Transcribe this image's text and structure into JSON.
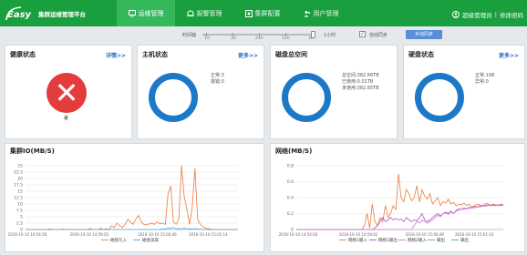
{
  "app": {
    "logo_text": "Easy",
    "name": "集群运维管理平台"
  },
  "nav": [
    {
      "label": "运维管理",
      "icon": "monitor-icon",
      "active": true
    },
    {
      "label": "报警管理",
      "icon": "alarm-icon",
      "active": false
    },
    {
      "label": "集群配置",
      "icon": "cluster-config-icon",
      "active": false
    },
    {
      "label": "用户管理",
      "icon": "users-icon",
      "active": false
    }
  ],
  "user": {
    "icon": "user-circle-icon",
    "role": "超级管理员",
    "separator": "|",
    "change_password": "修改密码"
  },
  "toolbar": {
    "time_label": "时间轴",
    "ticks": [
      "1d",
      "3d",
      "24h",
      "12h",
      "3h"
    ],
    "slider_value": "1小时",
    "auto_sync_label": "自动同步",
    "auto_sync_checked": true,
    "sync_button": "手动同步"
  },
  "health": {
    "title": "健康状态",
    "more": "详情>>",
    "status_icon": "error-x-icon",
    "status_text": "差",
    "status_color": "#e43c3c"
  },
  "hosts": {
    "title": "主机状态",
    "more": "更多>>",
    "lines": [
      "正常:3",
      "报错:0"
    ]
  },
  "disk_total": {
    "title": "磁盘总空间",
    "lines": [
      "总空间:382.66TB",
      "已使用:0.01TB",
      "未使用:382.65TB"
    ]
  },
  "disk_status": {
    "title": "硬盘状态",
    "more": "更多>>",
    "lines": [
      "正常:108",
      "异常:0"
    ]
  },
  "ring_color": "#1d78c8",
  "io_chart": {
    "title": "集群IO(MB/S)",
    "chart_data": {
      "type": "line",
      "title": "集群IO(MB/S)",
      "ylim": [
        0,
        25
      ],
      "y_ticks": [
        "0",
        "2.5",
        "5",
        "7.5",
        "10",
        "12.5",
        "15",
        "17.5",
        "20",
        "22.5",
        "25"
      ],
      "x_ticks": [
        "2016-10-10 14:54:26",
        "2016-10-10 14:59:02",
        "2016-10-10 15:00:46",
        "2016-10-10 15:01:14"
      ],
      "series": [
        {
          "name": "磁盘写入",
          "color": "#e87b3c",
          "values": [
            0,
            0,
            0,
            0,
            0,
            0,
            0,
            0,
            0,
            0.3,
            0,
            0,
            0,
            0,
            0.2,
            0,
            0,
            0,
            0,
            0,
            0,
            0,
            0,
            0,
            0.4,
            0,
            0,
            0,
            0.5,
            0,
            0.3,
            0,
            1.5,
            0.8,
            2.5,
            1.5,
            0.7,
            2,
            4,
            3,
            2,
            4,
            5.5,
            3,
            2,
            1.8,
            2.2,
            2.5,
            2,
            3,
            2.2,
            2.5,
            2,
            14,
            17,
            3,
            2,
            4,
            25,
            13,
            8,
            2,
            9,
            24,
            4,
            2,
            1,
            0.5,
            0.3,
            0.1,
            0,
            0,
            0,
            0,
            0,
            0,
            0,
            0,
            0,
            0
          ]
        },
        {
          "name": "磁盘读取",
          "color": "#5aa8e0",
          "values": [
            0,
            0,
            0,
            0,
            0,
            0,
            0,
            0,
            0,
            0,
            0,
            0,
            0,
            0,
            0,
            0,
            0,
            0,
            0,
            0,
            0,
            0,
            0,
            0,
            0,
            0,
            0,
            0,
            0,
            0,
            0,
            0,
            0,
            0,
            0,
            0,
            0,
            0,
            0,
            0,
            0,
            0,
            0,
            0,
            0,
            0,
            0,
            0,
            0,
            0,
            0,
            0.3,
            0.2,
            0.6,
            0.4,
            0.8,
            0.3,
            0.4,
            0.2,
            0.5,
            0.2,
            0.3,
            0.2,
            0.4,
            0.2,
            0.1,
            0,
            0,
            0,
            0,
            0,
            0,
            0,
            0,
            0,
            0,
            0,
            0,
            0,
            0
          ]
        }
      ]
    }
  },
  "net_chart": {
    "title": "网络(MB/S)",
    "chart_data": {
      "type": "line",
      "title": "网络(MB/S)",
      "ylim": [
        0,
        0.8
      ],
      "y_ticks": [
        "0",
        "0.2",
        "0.4",
        "0.6",
        "0.8"
      ],
      "x_ticks": [
        "2016-10-10 14:54:26",
        "2016-10-10 14:59:02",
        "2016-10-10 15:00:46",
        "2016-10-10 15:01:14"
      ],
      "legend": [
        "网络1输入",
        "网络1输出",
        "网络2输入",
        "输出",
        "输出"
      ],
      "series": [
        {
          "name": "网络1输入",
          "color": "#e87b3c",
          "values": [
            0,
            0,
            0,
            0,
            0,
            0,
            0,
            0,
            0,
            0,
            0,
            0,
            0,
            0,
            0,
            0,
            0,
            0,
            0,
            0,
            0,
            0,
            0,
            0,
            0,
            0,
            0.05,
            0.2,
            0.02,
            0.32,
            0.1,
            0.05,
            0.15,
            0.1,
            0.3,
            0.15,
            0.2,
            0.3,
            0.25,
            0.7,
            0.4,
            0.35,
            0.5,
            0.45,
            0.36,
            0.4,
            0.55,
            0.35,
            0.5,
            0.42,
            0.38,
            0.45,
            0.32,
            0.36,
            0.4,
            0.3,
            0.35,
            0.33,
            0.38,
            0.32,
            0.34,
            0.3,
            0.32,
            0.31,
            0.33,
            0.3,
            0.32,
            0.28,
            0.3,
            0.32,
            0.31,
            0.3,
            0.32,
            0.33,
            0.3,
            0.32,
            0.31,
            0.3,
            0.32,
            0.31
          ]
        },
        {
          "name": "网络1输出",
          "color": "#b04fbf",
          "values": [
            0,
            0,
            0,
            0,
            0,
            0,
            0,
            0,
            0,
            0,
            0,
            0,
            0,
            0,
            0,
            0,
            0,
            0,
            0,
            0,
            0,
            0,
            0,
            0,
            0,
            0,
            0,
            0,
            0,
            0,
            0.02,
            0.05,
            0.1,
            0.15,
            0.1,
            0.12,
            0.15,
            0.12,
            0.14,
            0.12,
            0.13,
            0.1,
            0.15,
            0.12,
            0.1,
            0.12,
            0.11,
            0.15,
            0.2,
            0.12,
            0.1,
            0.12,
            0.15,
            0.18,
            0.2,
            0.17,
            0.2,
            0.22,
            0.2,
            0.23,
            0.2,
            0.24,
            0.26,
            0.25,
            0.27,
            0.26,
            0.28,
            0.27,
            0.29,
            0.28,
            0.3,
            0.29,
            0.3,
            0.31,
            0.3,
            0.31,
            0.3,
            0.31,
            0.3,
            0.31
          ]
        },
        {
          "name": "网络2输入",
          "color": "#c97ad6",
          "values": [
            0,
            0,
            0,
            0,
            0,
            0,
            0,
            0,
            0,
            0,
            0,
            0,
            0,
            0,
            0,
            0,
            0,
            0,
            0,
            0,
            0,
            0,
            0,
            0,
            0,
            0,
            0,
            0,
            0,
            0,
            0,
            0,
            0,
            0,
            0,
            0,
            0,
            0,
            0,
            0,
            0,
            0,
            0,
            0,
            0,
            0.05,
            0.1,
            0.08,
            0.12,
            0.1,
            0.08,
            0.1,
            0.12,
            0.15,
            0.18,
            0.16,
            0.2,
            0.21,
            0.19,
            0.22,
            0.2,
            0.23,
            0.24,
            0.26,
            0.25,
            0.27,
            0.26,
            0.28,
            0.27,
            0.29,
            0.28,
            0.3,
            0.29,
            0.3,
            0.31,
            0.3,
            0.31,
            0.3,
            0.31,
            0.3
          ]
        }
      ]
    }
  }
}
